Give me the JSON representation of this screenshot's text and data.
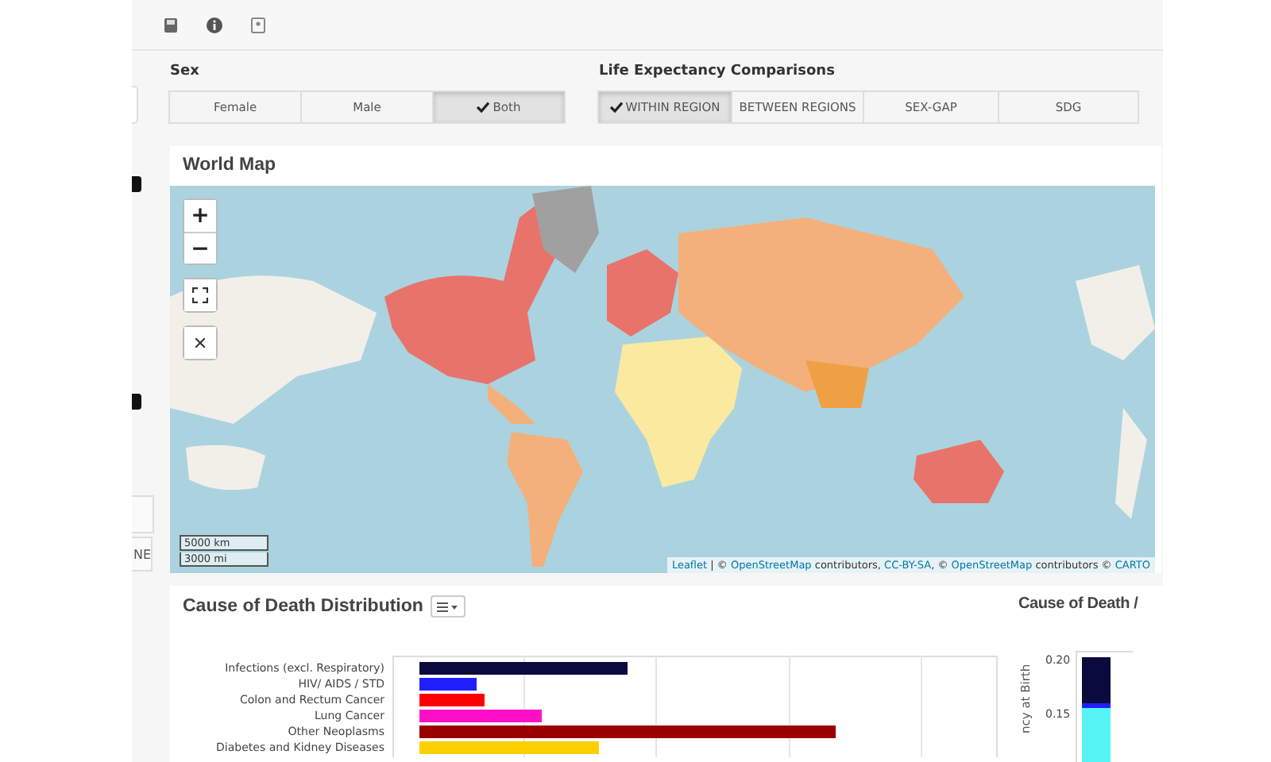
{
  "sidebar": {
    "button_text": "NE"
  },
  "sex": {
    "label": "Sex",
    "options": [
      {
        "label": "Female",
        "selected": false
      },
      {
        "label": "Male",
        "selected": false
      },
      {
        "label": "Both",
        "selected": true
      }
    ]
  },
  "comparisons": {
    "label": "Life Expectancy Comparisons",
    "options": [
      {
        "label": "WITHIN REGION",
        "selected": true
      },
      {
        "label": "BETWEEN REGIONS",
        "selected": false
      },
      {
        "label": "SEX-GAP",
        "selected": false
      },
      {
        "label": "SDG",
        "selected": false
      }
    ]
  },
  "world_map": {
    "title": "World Map",
    "zoom_in": "+",
    "zoom_out": "−",
    "scale": [
      "5000 km",
      "3000 mi"
    ],
    "attribution": [
      {
        "text": "Leaflet",
        "link": true
      },
      {
        "text": " | © ",
        "link": false
      },
      {
        "text": "OpenStreetMap",
        "link": true
      },
      {
        "text": " contributors, ",
        "link": false
      },
      {
        "text": "CC-BY-SA",
        "link": true
      },
      {
        "text": ", © ",
        "link": false
      },
      {
        "text": "OpenStreetMap",
        "link": true
      },
      {
        "text": " contributors © ",
        "link": false
      },
      {
        "text": "CARTO",
        "link": true
      }
    ]
  },
  "cause_distribution": {
    "title": "Cause of Death Distribution",
    "categories": [
      {
        "label": "Infections (excl. Respiratory)",
        "color": "#0a0a3c"
      },
      {
        "label": "HIV/ AIDS / STD",
        "color": "#2020ff"
      },
      {
        "label": "Colon and Rectum Cancer",
        "color": "#ff0000"
      },
      {
        "label": "Lung Cancer",
        "color": "#ff10c8"
      },
      {
        "label": "Other Neoplasms",
        "color": "#990000"
      },
      {
        "label": "Diabetes and Kidney Diseases",
        "color": "#ffd000"
      }
    ]
  },
  "cause_by": {
    "title": "Cause of Death /",
    "ylabel": "ncy at Birth",
    "yticks": [
      "0.20",
      "0.15"
    ]
  }
}
